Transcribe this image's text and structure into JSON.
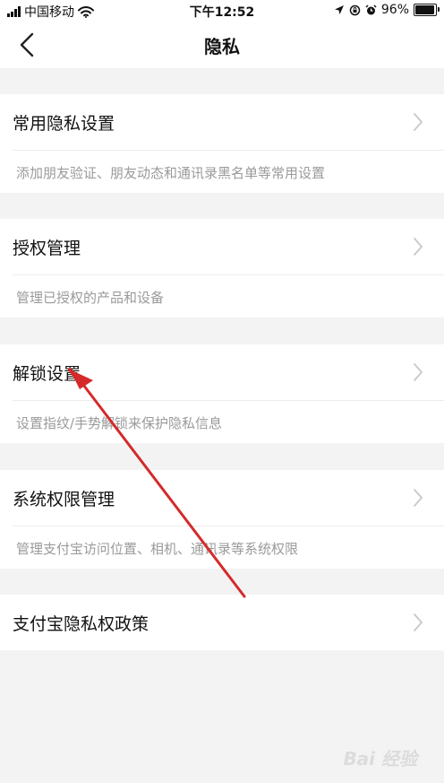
{
  "status_bar": {
    "carrier": "中国移动",
    "time": "下午12:52",
    "battery": "96%",
    "battery_level": 0.96
  },
  "nav": {
    "title": "隐私"
  },
  "sections": [
    {
      "title": "常用隐私设置",
      "description": "添加朋友验证、朋友动态和通讯录黑名单等常用设置"
    },
    {
      "title": "授权管理",
      "description": "管理已授权的产品和设备"
    },
    {
      "title": "解锁设置",
      "description": "设置指纹/手势解锁来保护隐私信息"
    },
    {
      "title": "系统权限管理",
      "description": "管理支付宝访问位置、相机、通讯录等系统权限"
    },
    {
      "title": "支付宝隐私权政策"
    }
  ],
  "watermark": "Bai 经验",
  "colors": {
    "annotation_arrow": "#d42a2a",
    "chevron": "#c8c8c8",
    "background": "#f3f3f3"
  }
}
